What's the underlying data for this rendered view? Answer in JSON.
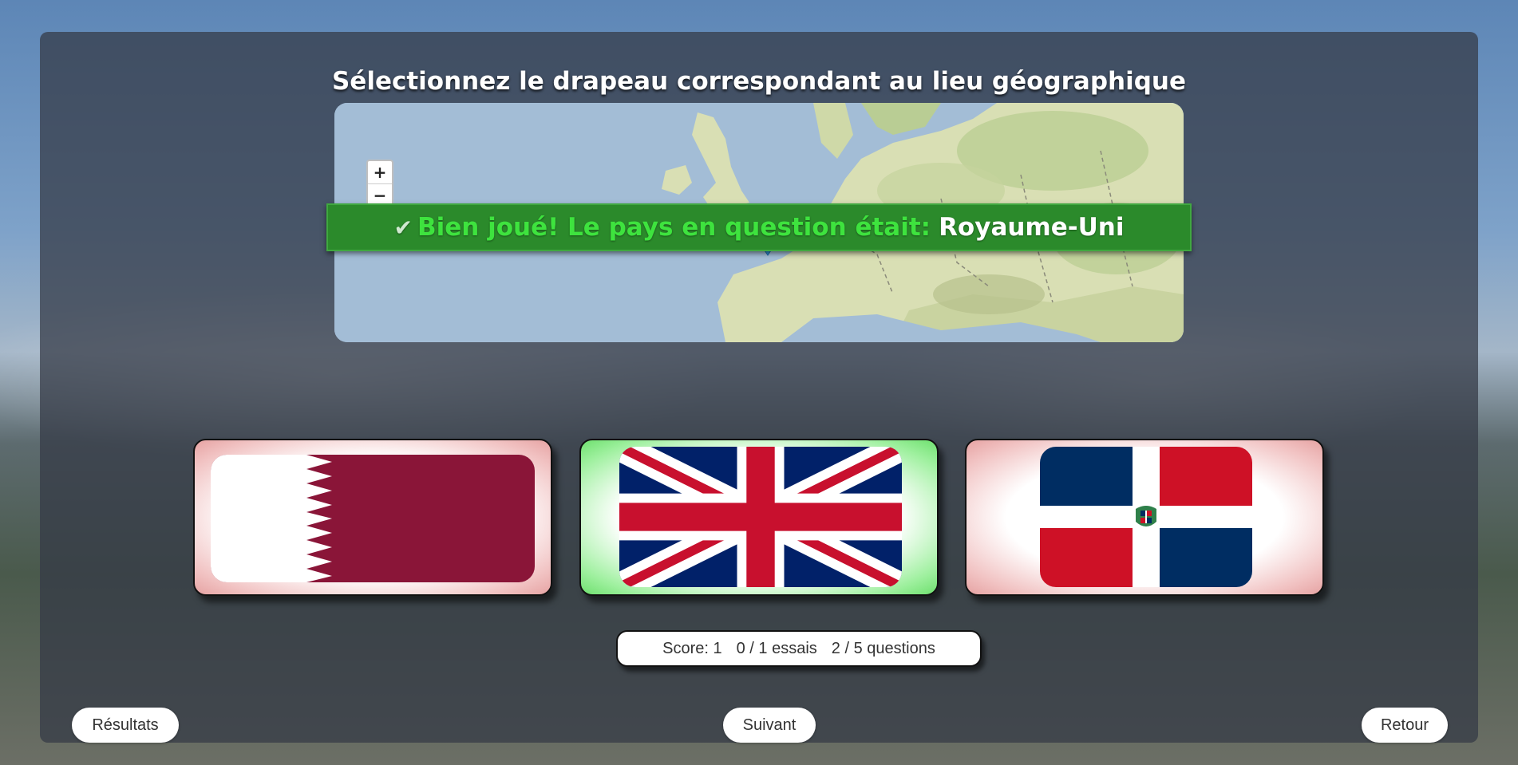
{
  "title": "Sélectionnez le drapeau correspondant au lieu géographique",
  "map": {
    "zoom_in_label": "+",
    "zoom_out_label": "−"
  },
  "feedback": {
    "message": "Bien joué! Le pays en question était:",
    "country": "Royaume-Uni"
  },
  "flags": [
    {
      "name": "Qatar",
      "status": "wrong"
    },
    {
      "name": "Royaume-Uni",
      "status": "correct"
    },
    {
      "name": "République dominicaine",
      "status": "wrong"
    }
  ],
  "score": {
    "score_text": "Score: 1",
    "attempts_text": "0 / 1 essais",
    "questions_text": "2 / 5 questions"
  },
  "buttons": {
    "results": "Résultats",
    "next": "Suivant",
    "back": "Retour"
  },
  "colors": {
    "success_banner": "#2b8a2b",
    "success_text": "#3ee33e",
    "correct_glow": "#6fe06f",
    "wrong_glow": "#e6a3a3"
  },
  "icons": [
    "check-icon",
    "map-marker-icon",
    "zoom-in-icon",
    "zoom-out-icon"
  ]
}
